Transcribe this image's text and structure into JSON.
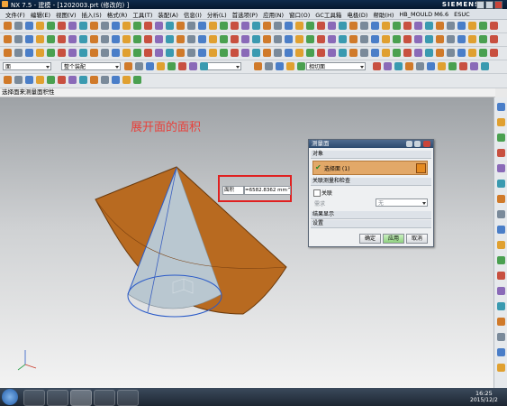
{
  "window": {
    "title": "NX 7.5 - 建模 - [1202003.prt  (修改的) ]",
    "brand": "SIEMENS"
  },
  "menu": [
    "文件(F)",
    "编辑(E)",
    "视图(V)",
    "插入(S)",
    "格式(R)",
    "工具(T)",
    "装配(A)",
    "信息(I)",
    "分析(L)",
    "首选项(P)",
    "应用(N)",
    "窗口(O)",
    "GC工具箱",
    "电极(D)",
    "帮助(H)",
    "HB_MOULD M6.6",
    "ESUC"
  ],
  "toolbar_selects": {
    "filter": "面",
    "assembly": "整个装配",
    "snap": "",
    "range": "相切面"
  },
  "status_line": "选择面来测量面积性",
  "annotation": "展开面的面积",
  "measure_callout": {
    "type_label": "面积",
    "value": "=6582.8362 mm^2"
  },
  "dialog": {
    "title": "测量面",
    "section_object": "对象",
    "select_face": "选择面 (1)",
    "section_assoc": "关联测量和检查",
    "assoc_checkbox": "关联",
    "require_label": "需求",
    "require_value": "无",
    "section_result": "结果显示",
    "section_settings": "设置",
    "ok": "确定",
    "apply": "应用",
    "cancel": "取消"
  },
  "clock": {
    "time": "16:25",
    "date": "2015/12/2"
  },
  "colors": {
    "face_fill": "#b86a20",
    "face_edge": "#6b3a0c",
    "cone_fill": "#b9c7d0",
    "callout_border": "#e02020",
    "annotation": "#e8403a",
    "select_highlight": "#e2a868"
  }
}
